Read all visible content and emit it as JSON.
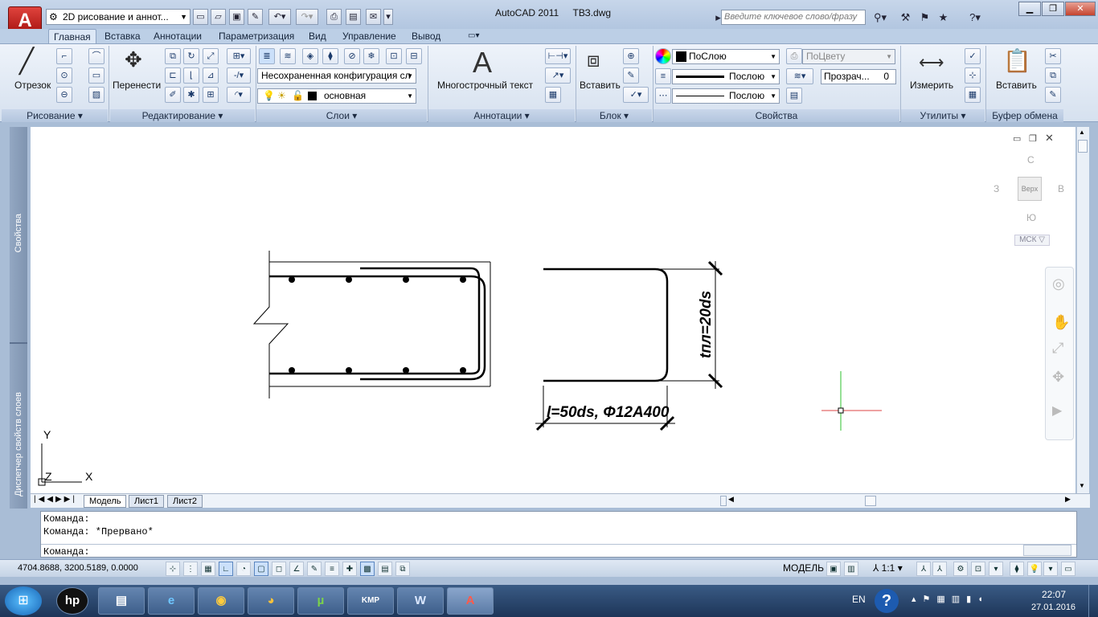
{
  "titlebar": {
    "app_button": "A",
    "workspace": "2D рисование и аннот...",
    "title": "AutoCAD 2011",
    "file": "ТВЗ.dwg",
    "search_placeholder": "Введите ключевое слово/фразу"
  },
  "tabs": [
    "Главная",
    "Вставка",
    "Аннотации",
    "Параметризация",
    "Вид",
    "Управление",
    "Вывод"
  ],
  "ribbon": {
    "draw": {
      "title": "Рисование",
      "line_label": "Отрезок"
    },
    "modify": {
      "title": "Редактирование",
      "move_label": "Перенести"
    },
    "layers": {
      "title": "Слои",
      "state": "Несохраненная конфигурация сл",
      "current_layer": "основная"
    },
    "annotation": {
      "title": "Аннотации",
      "mtext_label": "Многострочный текст"
    },
    "block": {
      "title": "Блок",
      "insert_label": "Вставить"
    },
    "properties": {
      "title": "Свойства",
      "color": "ПоСлою",
      "plot_style": "ПоЦвету",
      "linetype": "Послою",
      "lineweight": "Послою",
      "transparency_label": "Прозрач...",
      "transparency_value": "0"
    },
    "utilities": {
      "title": "Утилиты",
      "measure_label": "Измерить"
    },
    "clipboard": {
      "title": "Буфер обмена",
      "paste_label": "Вставить"
    }
  },
  "left_dock": {
    "properties": "Свойства",
    "layer_manager": "Диспетчер свойств слоев"
  },
  "viewcube": {
    "north": "С",
    "south": "Ю",
    "west": "З",
    "east": "В",
    "face": "Верх",
    "ucs": "МСК"
  },
  "drawing": {
    "dim_length": "l=50ds, Φ12A400",
    "dim_height": "tпл=20ds",
    "ucs_x": "X",
    "ucs_y": "Y",
    "ucs_z": "Z"
  },
  "layout_tabs": [
    "Модель",
    "Лист1",
    "Лист2"
  ],
  "command": {
    "line1": "Команда:",
    "line2": "Команда: *Прервано*",
    "prompt": "Команда:"
  },
  "status": {
    "coords": "4704.8688, 3200.5189, 0.0000",
    "space": "МОДЕЛЬ",
    "scale": "1:1"
  },
  "tray": {
    "lang": "EN",
    "time": "22:07",
    "date": "27.01.2016"
  }
}
